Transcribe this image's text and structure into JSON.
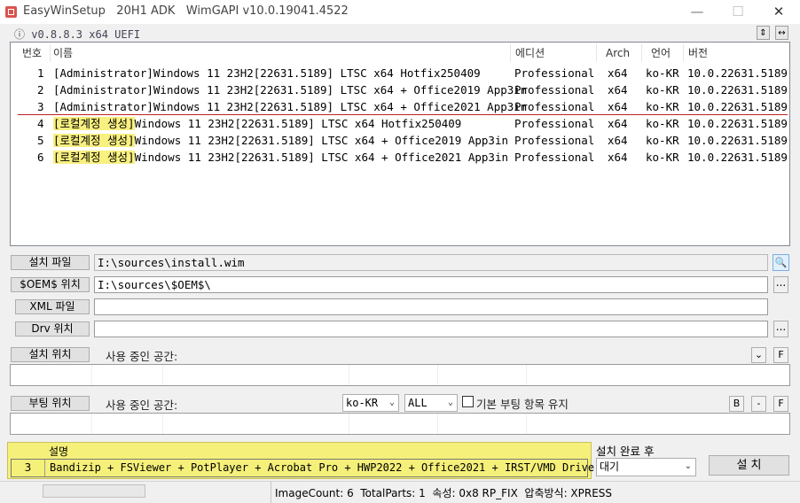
{
  "window": {
    "title": "EasyWinSetup   20H1 ADK   WimGAPI v10.0.19041.4522",
    "minimize_glyph": "—",
    "maximize_glyph": "☐",
    "close_glyph": "✕"
  },
  "version_label": "ⓘ v0.8.8.3 x64 UEFI",
  "sort_glyph": "⇕",
  "expand_glyph": "↔",
  "list": {
    "headers": {
      "num": "번호",
      "name": "이름",
      "edition": "에디션",
      "arch": "Arch",
      "lang": "언어",
      "version": "버전"
    },
    "rows": [
      {
        "num": "1",
        "prefix": "[Administrator]",
        "name": "Windows 11 23H2[22631.5189] LTSC x64 Hotfix250409",
        "edition": "Professional",
        "arch": "x64",
        "lang": "ko-KR",
        "version": "10.0.22631.5189"
      },
      {
        "num": "2",
        "prefix": "[Administrator]",
        "name": "Windows 11 23H2[22631.5189] LTSC x64 + Office2019 App3in",
        "edition": "Professional",
        "arch": "x64",
        "lang": "ko-KR",
        "version": "10.0.22631.5189"
      },
      {
        "num": "3",
        "prefix": "[Administrator]",
        "name": "Windows 11 23H2[22631.5189] LTSC x64 + Office2021 App3in",
        "edition": "Professional",
        "arch": "x64",
        "lang": "ko-KR",
        "version": "10.0.22631.5189"
      },
      {
        "num": "4",
        "prefix": "[로컬계정 생성]",
        "name": "Windows 11 23H2[22631.5189] LTSC x64 Hotfix250409",
        "edition": "Professional",
        "arch": "x64",
        "lang": "ko-KR",
        "version": "10.0.22631.5189"
      },
      {
        "num": "5",
        "prefix": "[로컬계정 생성]",
        "name": "Windows 11 23H2[22631.5189] LTSC x64 + Office2019 App3in",
        "edition": "Professional",
        "arch": "x64",
        "lang": "ko-KR",
        "version": "10.0.22631.5189"
      },
      {
        "num": "6",
        "prefix": "[로컬계정 생성]",
        "name": "Windows 11 23H2[22631.5189] LTSC x64 + Office2021 App3in",
        "edition": "Professional",
        "arch": "x64",
        "lang": "ko-KR",
        "version": "10.0.22631.5189"
      }
    ]
  },
  "form": {
    "install_file_label": "설치 파일",
    "install_file_value": "I:\\sources\\install.wim",
    "oem_label": "$OEM$ 위치",
    "oem_value": "I:\\sources\\$OEM$\\",
    "xml_label": "XML 파일",
    "xml_value": "",
    "drv_label": "Drv 위치",
    "drv_value": "",
    "browse_glyph": "...",
    "search_glyph": "🔍",
    "install_loc_label": "설치 위치",
    "install_space_label": "사용 중인 공간:",
    "boot_loc_label": "부팅 위치",
    "boot_space_label": "사용 중인 공간:",
    "lang_select": "ko-KR",
    "all_select": "ALL",
    "keep_boot_label": "기본 부팅 항목 유지",
    "btn_down": "⌄",
    "btn_f": "F",
    "btn_b": "B",
    "btn_minus": "-",
    "btn_f2": "F"
  },
  "desc": {
    "header": "설명",
    "num": "3",
    "text": "Bandizip + FSViewer + PotPlayer + Acrobat Pro + HWP2022 + Office2021 + IRST/VMD Driver"
  },
  "after_install": {
    "label": "설치 완료 후",
    "selected": "대기",
    "install_button": "설 치"
  },
  "status": "ImageCount: 6  TotalParts: 1  속성: 0x8 RP_FIX  압축방식: XPRESS",
  "colors": {
    "highlight": "#f8f080",
    "separator_line": "#c02020",
    "desc_bg": "#f5f07a"
  }
}
